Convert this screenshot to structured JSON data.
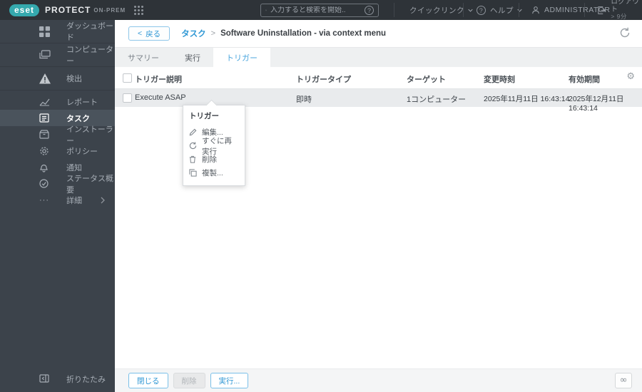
{
  "topbar": {
    "brand": {
      "logo_text": "eset",
      "product": "PROTECT",
      "edition": "ON-PREM"
    },
    "search": {
      "placeholder": "入力すると検索を開始.."
    },
    "quicklinks_label": "クイックリンク",
    "help_label": "ヘルプ",
    "user_label": "ADMINISTRATOR",
    "logout_label": "ログアウト",
    "logout_timer": "> 9分"
  },
  "sidebar": {
    "items": [
      {
        "label": "ダッシュボード",
        "icon": "dashboard-icon"
      },
      {
        "label": "コンピューター",
        "icon": "computers-icon"
      },
      {
        "label": "検出",
        "icon": "detections-icon"
      },
      {
        "label": "レポート",
        "icon": "reports-icon"
      },
      {
        "label": "タスク",
        "icon": "tasks-icon",
        "selected": true
      },
      {
        "label": "インストーラー",
        "icon": "installers-icon"
      },
      {
        "label": "ポリシー",
        "icon": "policies-icon"
      },
      {
        "label": "通知",
        "icon": "notifications-icon"
      },
      {
        "label": "ステータス概要",
        "icon": "status-overview-icon"
      },
      {
        "label": "詳細",
        "icon": "more-icon",
        "has_submenu": true
      }
    ],
    "collapse_label": "折りたたみ"
  },
  "header": {
    "back_chevron": "<",
    "back_label": "戻る",
    "breadcrumb_root": "タスク",
    "breadcrumb_sep": ">",
    "page_title": "Software Uninstallation - via context menu"
  },
  "tabs": [
    {
      "label": "サマリー",
      "active": false
    },
    {
      "label": "実行",
      "active": false
    },
    {
      "label": "トリガー",
      "active": true
    }
  ],
  "table": {
    "columns": [
      "トリガー説明",
      "トリガータイプ",
      "ターゲット",
      "変更時刻",
      "有効期間"
    ],
    "rows": [
      {
        "description": "Execute ASAP",
        "type": "即時",
        "target": "1コンピューター",
        "modified": "2025年11月11日 16:43:14",
        "validity": "2025年12月11日 16:43:14",
        "selected": true
      }
    ]
  },
  "context_menu": {
    "title": "トリガー",
    "items": [
      {
        "label": "編集...",
        "icon": "pencil-icon"
      },
      {
        "label": "すぐに再実行",
        "icon": "rerun-icon"
      },
      {
        "label": "削除",
        "icon": "trash-icon"
      },
      {
        "label": "複製...",
        "icon": "copy-icon"
      }
    ]
  },
  "footer": {
    "buttons": [
      {
        "label": "閉じる",
        "enabled": true
      },
      {
        "label": "削除",
        "enabled": false
      },
      {
        "label": "実行...",
        "enabled": true
      }
    ]
  },
  "glyphs": {
    "question": "?",
    "gear": "⚙",
    "more_dots": "···",
    "infinity": "∞"
  },
  "colors": {
    "accent_blue": "#2d96d4",
    "brand_teal": "#35a9ae",
    "topbar_bg": "#2e3338",
    "sidebar_bg": "#3c434b",
    "sidebar_selected_bg": "#4a535c",
    "selected_row_bg": "#e9ebed",
    "tabbar_bg": "#eef0f1"
  }
}
